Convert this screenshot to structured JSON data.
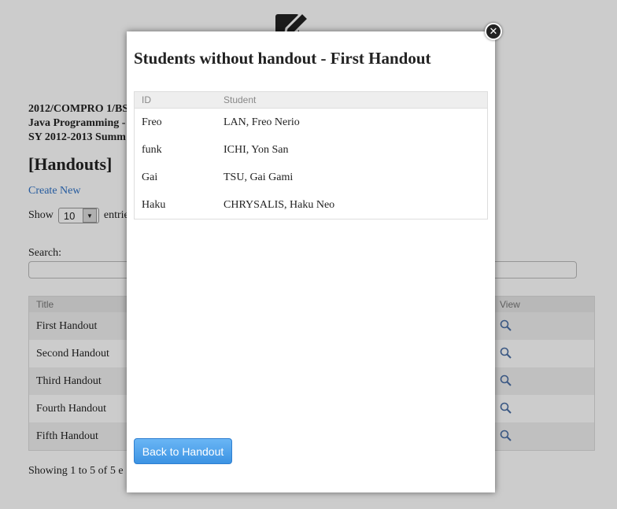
{
  "background": {
    "course_lines": [
      "2012/COMPRO 1/BS",
      "Java Programming -",
      "SY 2012-2013 Summ"
    ],
    "section_title": "[Handouts]",
    "create_new": "Create New",
    "show_label": "Show",
    "entries_value": "10",
    "entries_suffix": "entrie",
    "search_label": "Search:",
    "table": {
      "headers": [
        "Title",
        "View"
      ],
      "rows": [
        "First Handout",
        "Second Handout",
        "Third Handout",
        "Fourth Handout",
        "Fifth Handout"
      ]
    },
    "footer_info": "Showing 1 to 5 of 5 e"
  },
  "modal": {
    "title": "Students without handout - First Handout",
    "close_icon": "close-icon",
    "headers": [
      "ID",
      "Student"
    ],
    "rows": [
      {
        "id": "Freo",
        "student": "LAN, Freo Nerio"
      },
      {
        "id": "funk",
        "student": "ICHI, Yon San"
      },
      {
        "id": "Gai",
        "student": "TSU, Gai Gami"
      },
      {
        "id": "Haku",
        "student": "CHRYSALIS, Haku Neo"
      }
    ],
    "back_button": "Back to Handout"
  },
  "colors": {
    "accent": "#3c93e3",
    "link": "#2f72c6",
    "overlay": "rgba(0,0,0,0.2)"
  }
}
